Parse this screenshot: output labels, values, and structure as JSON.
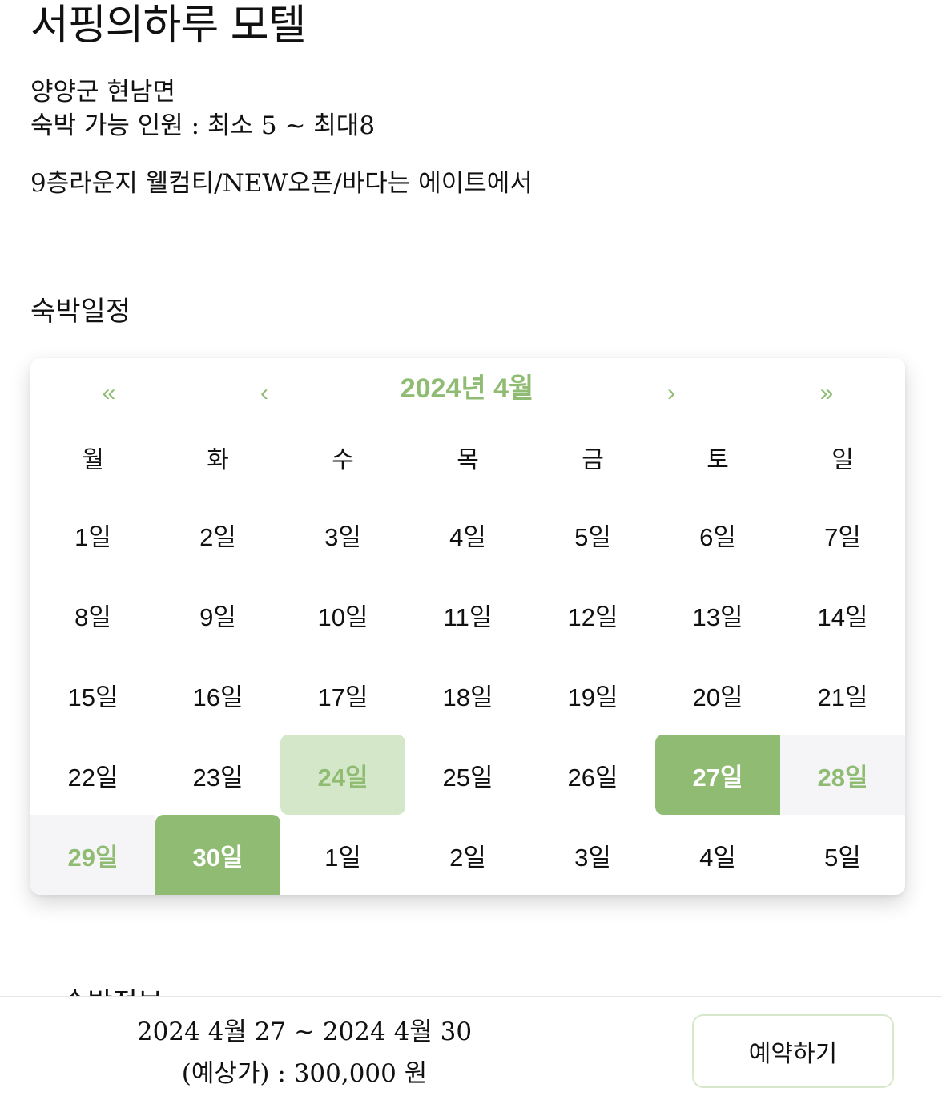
{
  "listing": {
    "title": "서핑의하루 모텔",
    "location": "양양군 현남면",
    "capacity": "숙박 가능 인원 : 최소 5 ~ 최대8",
    "tagline": "9층라운지 웰컴티/NEW오픈/바다는 에이트에서"
  },
  "schedule": {
    "heading": "숙박일정",
    "calendar": {
      "month_label": "2024년 4월",
      "nav_first": "«",
      "nav_prev": "‹",
      "nav_next": "›",
      "nav_last": "»",
      "weekdays": [
        "월",
        "화",
        "수",
        "목",
        "금",
        "토",
        "일"
      ],
      "days": [
        "1일",
        "2일",
        "3일",
        "4일",
        "5일",
        "6일",
        "7일",
        "8일",
        "9일",
        "10일",
        "11일",
        "12일",
        "13일",
        "14일",
        "15일",
        "16일",
        "17일",
        "18일",
        "19일",
        "20일",
        "21일",
        "22일",
        "23일",
        "24일",
        "25일",
        "26일",
        "27일",
        "28일",
        "29일",
        "30일",
        "1일",
        "2일",
        "3일",
        "4일",
        "5일"
      ],
      "today_index": 23,
      "range_start_index": 26,
      "range_end_index": 29,
      "weekend_highlight_indices": [
        27,
        28
      ],
      "accent_color": "#8fbc72",
      "today_bg_color": "#d4e8c9",
      "weekend_bg_color": "#f5f5f8"
    }
  },
  "next_section": {
    "heading": "숙박정보"
  },
  "booking": {
    "date_range": "2024 4월 27 ~ 2024 4월 30",
    "price": "(예상가) : 300,000 원",
    "button_label": "예약하기"
  }
}
